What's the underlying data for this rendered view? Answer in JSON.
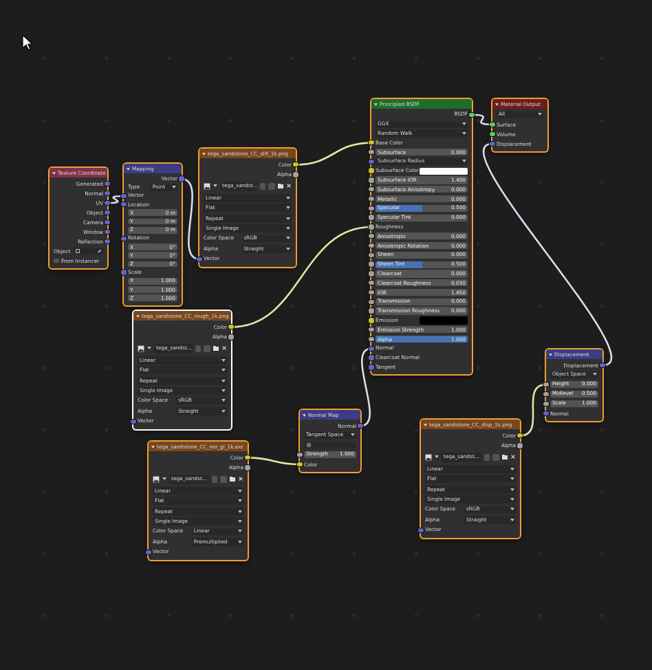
{
  "nodes": [
    {
      "title": "Texture Coordinate",
      "kind": "input",
      "selected": true,
      "active": false,
      "rows": [
        {
          "kind": "output",
          "label": "Generated",
          "socket": {
            "color": "#6363c7"
          }
        },
        {
          "kind": "output",
          "label": "Normal",
          "socket": {
            "color": "#6363c7"
          }
        },
        {
          "kind": "output",
          "label": "UV",
          "socket": {
            "color": "#6363c7"
          }
        },
        {
          "kind": "output",
          "label": "Object",
          "socket": {
            "color": "#6363c7"
          }
        },
        {
          "kind": "output",
          "label": "Camera",
          "socket": {
            "color": "#6363c7"
          }
        },
        {
          "kind": "output",
          "label": "Window",
          "socket": {
            "color": "#6363c7"
          }
        },
        {
          "kind": "output",
          "label": "Reflection",
          "socket": {
            "color": "#6363c7"
          }
        },
        {
          "kind": "object",
          "label": "Object"
        },
        {
          "kind": "checkbox",
          "label": "From Instancer",
          "checked": false
        }
      ]
    },
    {
      "title": "Mapping",
      "kind": "vector",
      "selected": true,
      "active": false,
      "rows": [
        {
          "kind": "output",
          "label": "Vector",
          "socket": {
            "color": "#6363c7"
          }
        },
        {
          "kind": "prop",
          "label": "Type",
          "value": "Point"
        },
        {
          "kind": "input",
          "label": "Vector",
          "socket": {
            "color": "#6363c7"
          }
        },
        {
          "kind": "input",
          "label": "Location",
          "socket": {
            "color": "#6363c7"
          }
        },
        {
          "kind": "value",
          "label": "X",
          "value": "0 m"
        },
        {
          "kind": "value",
          "label": "Y",
          "value": "0 m"
        },
        {
          "kind": "value",
          "label": "Z",
          "value": "0 m"
        },
        {
          "kind": "input",
          "label": "Rotation",
          "socket": {
            "color": "#6363c7"
          }
        },
        {
          "kind": "value",
          "label": "X",
          "value": "0°"
        },
        {
          "kind": "value",
          "label": "Y",
          "value": "0°"
        },
        {
          "kind": "value",
          "label": "Z",
          "value": "0°"
        },
        {
          "kind": "input",
          "label": "Scale",
          "socket": {
            "color": "#6363c7"
          }
        },
        {
          "kind": "value",
          "label": "X",
          "value": "1.000"
        },
        {
          "kind": "value",
          "label": "Y",
          "value": "1.000"
        },
        {
          "kind": "value",
          "label": "Z",
          "value": "1.000"
        }
      ]
    },
    {
      "title": "tega_sandstone_CC_diff_1k.png",
      "kind": "texture",
      "selected": true,
      "active": false,
      "rows": [
        {
          "kind": "output",
          "label": "Color",
          "socket": {
            "color": "#c7c729"
          }
        },
        {
          "kind": "output",
          "label": "Alpha",
          "socket": {
            "color": "#a1a1a1"
          }
        },
        {
          "kind": "image",
          "label": "tega_sandst..."
        },
        {
          "kind": "dropdown",
          "label": "Linear"
        },
        {
          "kind": "dropdown",
          "label": "Flat"
        },
        {
          "kind": "dropdown",
          "label": "Repeat"
        },
        {
          "kind": "dropdown",
          "label": "Single Image"
        },
        {
          "kind": "prop",
          "label": "Color Space",
          "value": "sRGB"
        },
        {
          "kind": "prop",
          "label": "Alpha",
          "value": "Straight"
        },
        {
          "kind": "input",
          "label": "Vector",
          "socket": {
            "color": "#6363c7"
          }
        }
      ]
    },
    {
      "title": "tega_sandstone_CC_rough_1k.png",
      "kind": "texture",
      "selected": true,
      "active": true,
      "rows": [
        {
          "kind": "output",
          "label": "Color",
          "socket": {
            "color": "#c7c729"
          }
        },
        {
          "kind": "output",
          "label": "Alpha",
          "socket": {
            "color": "#a1a1a1"
          }
        },
        {
          "kind": "image",
          "label": "tega_sandst..."
        },
        {
          "kind": "dropdown",
          "label": "Linear"
        },
        {
          "kind": "dropdown",
          "label": "Flat"
        },
        {
          "kind": "dropdown",
          "label": "Repeat"
        },
        {
          "kind": "dropdown",
          "label": "Single Image"
        },
        {
          "kind": "prop",
          "label": "Color Space",
          "value": "sRGB"
        },
        {
          "kind": "prop",
          "label": "Alpha",
          "value": "Straight"
        },
        {
          "kind": "input",
          "label": "Vector",
          "socket": {
            "color": "#6363c7"
          }
        }
      ]
    },
    {
      "title": "tega_sandstone_CC_nor_gl_1k.exr",
      "kind": "texture",
      "selected": true,
      "active": false,
      "rows": [
        {
          "kind": "output",
          "label": "Color",
          "socket": {
            "color": "#c7c729"
          }
        },
        {
          "kind": "output",
          "label": "Alpha",
          "socket": {
            "color": "#a1a1a1"
          }
        },
        {
          "kind": "image",
          "label": "tega_sandst..."
        },
        {
          "kind": "dropdown",
          "label": "Linear"
        },
        {
          "kind": "dropdown",
          "label": "Flat"
        },
        {
          "kind": "dropdown",
          "label": "Repeat"
        },
        {
          "kind": "dropdown",
          "label": "Single Image"
        },
        {
          "kind": "prop",
          "label": "Color Space",
          "value": "Linear"
        },
        {
          "kind": "prop",
          "label": "Alpha",
          "value": "Premultiplied"
        },
        {
          "kind": "input",
          "label": "Vector",
          "socket": {
            "color": "#6363c7"
          }
        }
      ]
    },
    {
      "title": "Normal Map",
      "kind": "vector",
      "selected": true,
      "active": false,
      "rows": [
        {
          "kind": "output",
          "label": "Normal",
          "socket": {
            "color": "#6363c7"
          }
        },
        {
          "kind": "dropdown",
          "label": "Tangent Space"
        },
        {
          "kind": "uvfield"
        },
        {
          "kind": "value",
          "label": "Strength",
          "value": "1.000",
          "socket": {
            "color": "#a1a1a1"
          }
        },
        {
          "kind": "input",
          "label": "Color",
          "socket": {
            "color": "#c7c729"
          }
        }
      ]
    },
    {
      "title": "Principled BSDF",
      "kind": "shader",
      "selected": true,
      "active": false,
      "rows": [
        {
          "kind": "output",
          "label": "BSDF",
          "socket": {
            "color": "#63c763"
          }
        },
        {
          "kind": "dropdown",
          "label": "GGX"
        },
        {
          "kind": "dropdown",
          "label": "Random Walk"
        },
        {
          "kind": "input",
          "label": "Base Color",
          "socket": {
            "color": "#c7c729"
          }
        },
        {
          "kind": "value",
          "label": "Subsurface",
          "value": "0.000",
          "socket": {
            "color": "#a1a1a1"
          }
        },
        {
          "kind": "dropdown",
          "label": "Subsurface Radius",
          "socket": {
            "color": "#6363c7"
          }
        },
        {
          "kind": "color",
          "label": "Subsurface Color",
          "socket": {
            "color": "#c7c729"
          },
          "color": "#ffffff"
        },
        {
          "kind": "value",
          "label": "Subsurface IOR",
          "value": "1.400",
          "socket": {
            "color": "#a1a1a1"
          }
        },
        {
          "kind": "value",
          "label": "Subsurface Anisotropy",
          "value": "0.000",
          "socket": {
            "color": "#a1a1a1"
          }
        },
        {
          "kind": "value",
          "label": "Metallic",
          "value": "0.000",
          "socket": {
            "color": "#a1a1a1"
          }
        },
        {
          "kind": "value",
          "label": "Specular",
          "value": "0.500",
          "socket": {
            "color": "#a1a1a1"
          },
          "level": 0.5
        },
        {
          "kind": "value",
          "label": "Specular Tint",
          "value": "0.000",
          "socket": {
            "color": "#a1a1a1"
          }
        },
        {
          "kind": "input",
          "label": "Roughness",
          "socket": {
            "color": "#a1a1a1"
          }
        },
        {
          "kind": "value",
          "label": "Anisotropic",
          "value": "0.000",
          "socket": {
            "color": "#a1a1a1"
          }
        },
        {
          "kind": "value",
          "label": "Anisotropic Rotation",
          "value": "0.000",
          "socket": {
            "color": "#a1a1a1"
          }
        },
        {
          "kind": "value",
          "label": "Sheen",
          "value": "0.000",
          "socket": {
            "color": "#a1a1a1"
          }
        },
        {
          "kind": "value",
          "label": "Sheen Tint",
          "value": "0.500",
          "socket": {
            "color": "#a1a1a1"
          },
          "level": 0.5
        },
        {
          "kind": "value",
          "label": "Clearcoat",
          "value": "0.000",
          "socket": {
            "color": "#a1a1a1"
          }
        },
        {
          "kind": "value",
          "label": "Clearcoat Roughness",
          "value": "0.030",
          "socket": {
            "color": "#a1a1a1"
          }
        },
        {
          "kind": "value",
          "label": "IOR",
          "value": "1.450",
          "socket": {
            "color": "#a1a1a1"
          }
        },
        {
          "kind": "value",
          "label": "Transmission",
          "value": "0.000",
          "socket": {
            "color": "#a1a1a1"
          }
        },
        {
          "kind": "value",
          "label": "Transmission Roughness",
          "value": "0.000",
          "socket": {
            "color": "#a1a1a1"
          }
        },
        {
          "kind": "color",
          "label": "Emission",
          "socket": {
            "color": "#c7c729"
          },
          "color": "#000000"
        },
        {
          "kind": "value",
          "label": "Emission Strength",
          "value": "1.000",
          "socket": {
            "color": "#a1a1a1"
          }
        },
        {
          "kind": "value",
          "label": "Alpha",
          "value": "1.000",
          "socket": {
            "color": "#a1a1a1"
          },
          "level": 1
        },
        {
          "kind": "input",
          "label": "Normal",
          "socket": {
            "color": "#6363c7"
          }
        },
        {
          "kind": "input",
          "label": "Clearcoat Normal",
          "socket": {
            "color": "#6363c7"
          }
        },
        {
          "kind": "input",
          "label": "Tangent",
          "socket": {
            "color": "#6363c7"
          }
        }
      ]
    },
    {
      "title": "Material Output",
      "kind": "output",
      "selected": true,
      "active": false,
      "rows": [
        {
          "kind": "dropdown",
          "label": "All"
        },
        {
          "kind": "input",
          "label": "Surface",
          "socket": {
            "color": "#63c763"
          }
        },
        {
          "kind": "input",
          "label": "Volume",
          "socket": {
            "color": "#63c763"
          }
        },
        {
          "kind": "input",
          "label": "Displacement",
          "socket": {
            "color": "#6363c7"
          }
        }
      ]
    },
    {
      "title": "Displacement",
      "kind": "vector",
      "selected": true,
      "active": false,
      "rows": [
        {
          "kind": "output",
          "label": "Displacement",
          "socket": {
            "color": "#6363c7"
          }
        },
        {
          "kind": "dropdown",
          "label": "Object Space"
        },
        {
          "kind": "value",
          "label": "Height",
          "value": "0.000",
          "socket": {
            "color": "#a1a1a1"
          }
        },
        {
          "kind": "value",
          "label": "Midlevel",
          "value": "0.500",
          "socket": {
            "color": "#a1a1a1"
          }
        },
        {
          "kind": "value",
          "label": "Scale",
          "value": "1.000",
          "socket": {
            "color": "#a1a1a1"
          }
        },
        {
          "kind": "input",
          "label": "Normal",
          "socket": {
            "color": "#6363c7"
          }
        }
      ]
    },
    {
      "title": "tega_sandstone_CC_disp_1k.png",
      "kind": "texture",
      "selected": true,
      "active": false,
      "rows": [
        {
          "kind": "output",
          "label": "Color",
          "socket": {
            "color": "#c7c729"
          }
        },
        {
          "kind": "output",
          "label": "Alpha",
          "socket": {
            "color": "#a1a1a1"
          }
        },
        {
          "kind": "image",
          "label": "tega_sandst..."
        },
        {
          "kind": "dropdown",
          "label": "Linear"
        },
        {
          "kind": "dropdown",
          "label": "Flat"
        },
        {
          "kind": "dropdown",
          "label": "Repeat"
        },
        {
          "kind": "dropdown",
          "label": "Single Image"
        },
        {
          "kind": "prop",
          "label": "Color Space",
          "value": "sRGB"
        },
        {
          "kind": "prop",
          "label": "Alpha",
          "value": "Straight"
        },
        {
          "kind": "input",
          "label": "Vector",
          "socket": {
            "color": "#6363c7"
          }
        }
      ]
    }
  ]
}
